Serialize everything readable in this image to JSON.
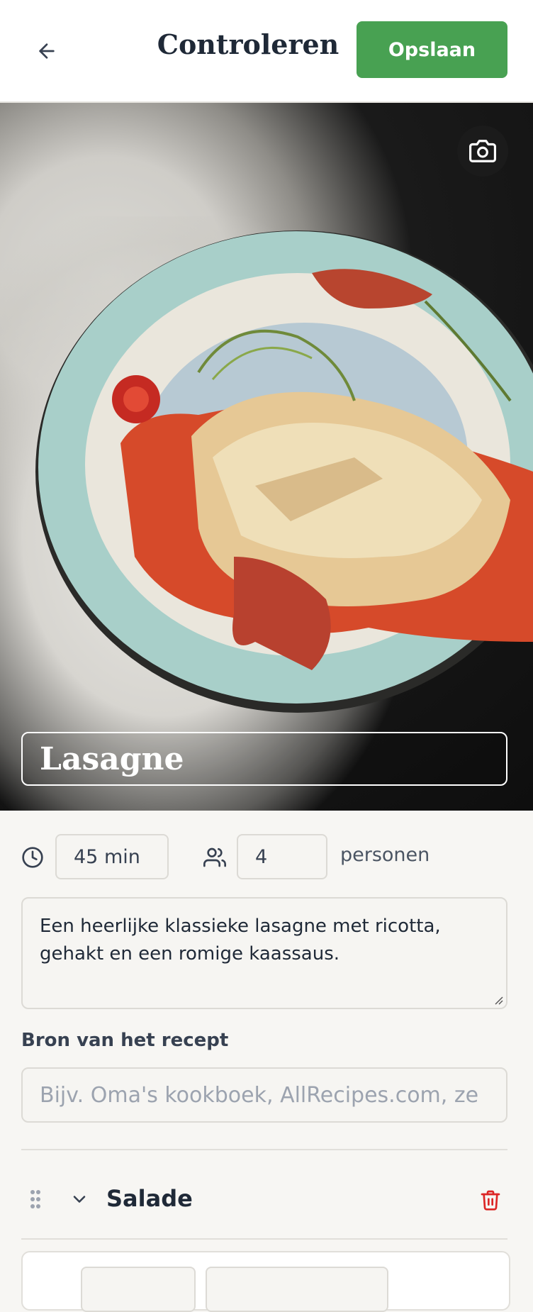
{
  "header": {
    "title": "Controleren",
    "save_label": "Opslaan"
  },
  "recipe": {
    "title": "Lasagne",
    "time": "45 min",
    "servings": "4",
    "servings_unit": "personen",
    "description": "Een heerlijke klassieke lasagne met ricotta, gehakt en een romige kaassaus."
  },
  "source": {
    "label": "Bron van het recept",
    "placeholder": "Bijv. Oma's kookboek, AllRecipes.com, ze"
  },
  "sections": [
    {
      "title": "Salade"
    }
  ],
  "colors": {
    "accent": "#48a152",
    "danger": "#dc2626"
  }
}
